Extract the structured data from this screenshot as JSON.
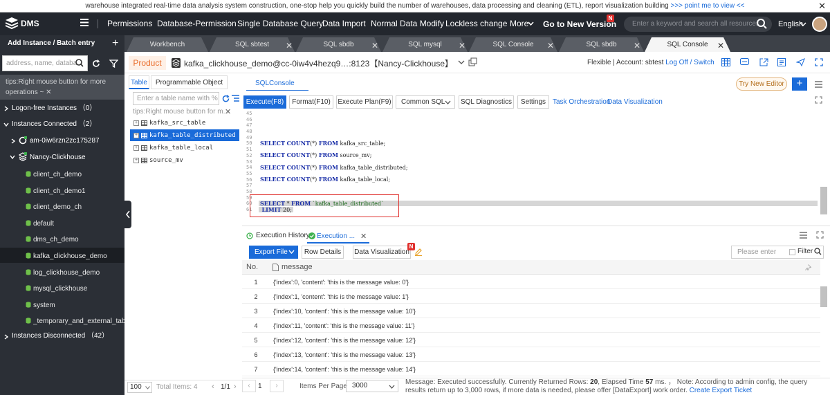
{
  "banner": {
    "text": "warehouse integrated real-time data analysis system construction, one-stop help you quickly build the number of warehouses, data processing and cleaning (ETL), report visualization building",
    "link": ">>> point me to view <<",
    "close": "✕"
  },
  "topnav": {
    "logo": "DMS",
    "items": [
      "Permissions",
      "Database-Permission",
      "Single Database Query",
      "Data Import",
      "Normal Data Modify",
      "Lockless change",
      "More"
    ],
    "new_version": "Go to New Version",
    "new_badge": "N",
    "search_placeholder": "Enter a keyword and search all resources",
    "language": "English"
  },
  "tabsbar": {
    "add_instance": "Add Instance / Batch entry",
    "add_plus": "+",
    "tabs": [
      {
        "label": "Workbench",
        "closable": false,
        "active": false
      },
      {
        "label": "SQL sbtest",
        "closable": true,
        "active": false
      },
      {
        "label": "SQL sbdb",
        "closable": true,
        "active": false
      },
      {
        "label": "SQL mysql",
        "closable": true,
        "active": false
      },
      {
        "label": "SQL Console",
        "closable": true,
        "active": false
      },
      {
        "label": "SQL sbdb",
        "closable": true,
        "active": false
      },
      {
        "label": "SQL Console",
        "closable": true,
        "active": true
      }
    ]
  },
  "sidebar": {
    "search_placeholder": "address, name, databa",
    "tips": "tips:Right mouse button for more operations ~",
    "tips_close": "✕",
    "groups": {
      "logon_free": "Logon-free Instances （0）",
      "connected": "Instances Connected （2）",
      "disconnected": "Instances Disconnected （42）"
    },
    "instances": [
      "am-0iw6rzn2zc175287",
      "Nancy-Clickhouse"
    ],
    "databases": [
      "client_ch_demo",
      "client_ch_demo1",
      "client_demo_ch",
      "default",
      "dms_ch_demo",
      "kafka_clickhouse_demo",
      "log_clickhouse_demo",
      "mysql_clickhouse",
      "system",
      "_temporary_and_external_tables"
    ],
    "selected_database": "kafka_clickhouse_demo"
  },
  "productbar": {
    "product": "Product",
    "title": "kafka_clickhouse_demo@cc-0iw4v4hezq9…:8123【Nancy-Clickhouse】",
    "mode": "Flexible | Account: sbtest",
    "logoff": "Log Off / Switch"
  },
  "objects": {
    "tabs": [
      "Table",
      "Programmable Object"
    ],
    "search_placeholder": "Enter a table name with % fo",
    "tips": "tips:Right mouse button for m...",
    "tips_close": "✕",
    "tables": [
      "kafka_src_table",
      "kafka_table_distributed",
      "kafka_table_local",
      "source_mv"
    ],
    "selected_table": "kafka_table_distributed",
    "footer": {
      "page_size": "100",
      "total": "Total Items: 4",
      "pages": "1/1"
    }
  },
  "editor": {
    "tab": "SQLConsole",
    "try_new": "Try New Editor",
    "plus": "+",
    "toolbar": [
      "Execute(F8)",
      "Format(F10)",
      "Execute Plan(F9)",
      "Common SQL",
      "SQL Diagnostics",
      "Settings"
    ],
    "links": [
      "Task Orchestration",
      "Data Visualization"
    ],
    "lines": [
      {
        "n": "45",
        "code": ""
      },
      {
        "n": "46",
        "code": ""
      },
      {
        "n": "47",
        "code": ""
      },
      {
        "n": "48",
        "code": ""
      },
      {
        "n": "49",
        "code": ""
      },
      {
        "n": "50",
        "code": "SELECT COUNT(*) FROM kafka_src_table;"
      },
      {
        "n": "51",
        "code": ""
      },
      {
        "n": "52",
        "code": "SELECT COUNT(*) FROM source_mv;"
      },
      {
        "n": "53",
        "code": ""
      },
      {
        "n": "54",
        "code": "SELECT COUNT(*) FROM kafka_table_distributed;"
      },
      {
        "n": "55",
        "code": ""
      },
      {
        "n": "56",
        "code": "SELECT COUNT(*) FROM kafka_table_local;"
      },
      {
        "n": "57",
        "code": ""
      },
      {
        "n": "58",
        "code": ""
      },
      {
        "n": "59",
        "code": ""
      },
      {
        "n": "60",
        "code": "SELECT * FROM `kafka_table_distributed`"
      },
      {
        "n": "61",
        "code": " LIMIT 20;"
      }
    ]
  },
  "results": {
    "history_tab": "Execution History",
    "exec_tab": "Execution ...",
    "buttons": [
      "Export File",
      "Row Details",
      "Data Visualization"
    ],
    "dv_badge": "N",
    "filter_placeholder": "Please enter",
    "filter_label": "Filter",
    "columns": [
      "No.",
      "message"
    ],
    "rows": [
      {
        "no": "1",
        "message": "{'index':0, 'content': 'this is the message value: 0'}"
      },
      {
        "no": "2",
        "message": "{'index':1, 'content': 'this is the message value: 1'}"
      },
      {
        "no": "3",
        "message": "{'index':10, 'content': 'this is the message value: 10'}"
      },
      {
        "no": "4",
        "message": "{'index':11, 'content': 'this is the message value: 11'}"
      },
      {
        "no": "5",
        "message": "{'index':12, 'content': 'this is the message value: 12'}"
      },
      {
        "no": "6",
        "message": "{'index':13, 'content': 'this is the message value: 13'}"
      },
      {
        "no": "7",
        "message": "{'index':14, 'content': 'this is the message value: 14'}"
      }
    ],
    "footer": {
      "page": "1",
      "items_per_page_label": "Items Per Page",
      "items_per_page": "3000",
      "status_a": "Message: Executed successfully. Currently Returned Rows:",
      "rows_returned": "20",
      "status_b": ", Elapsed Time",
      "elapsed": "57",
      "status_c": "ms. ， Note: According to admin config, the query results return up to 3,000 rows, if more data is needed, please offer [DataExport] work order.",
      "export_link": "Create Export Ticket"
    }
  }
}
